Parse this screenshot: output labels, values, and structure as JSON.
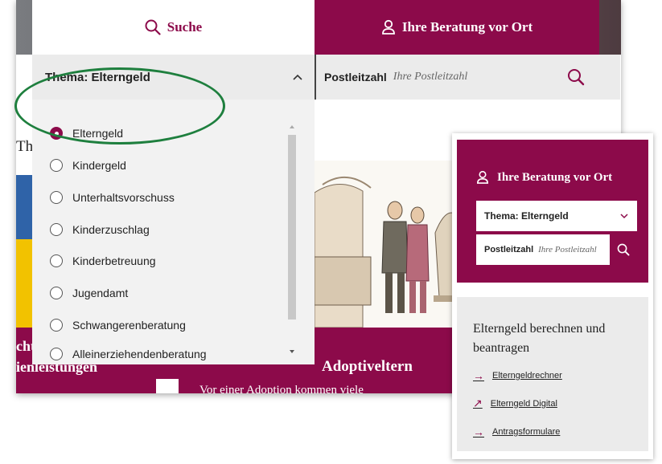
{
  "tabs": {
    "suche": "Suche",
    "ort": "Ihre Beratung vor Ort"
  },
  "search": {
    "thema": "Thema: Elterngeld",
    "plz_label": "Postleitzahl",
    "plz_placeholder": "Ihre Postleitzahl"
  },
  "dropdown": {
    "options": [
      {
        "label": "Elterngeld",
        "selected": true
      },
      {
        "label": "Kindergeld",
        "selected": false
      },
      {
        "label": "Unterhaltsvorschuss",
        "selected": false
      },
      {
        "label": "Kinderzuschlag",
        "selected": false
      },
      {
        "label": "Kinderbetreuung",
        "selected": false
      },
      {
        "label": "Jugendamt",
        "selected": false
      },
      {
        "label": "Schwangerenberatung",
        "selected": false
      },
      {
        "label": "Alleinerziehendenberatung",
        "selected": false
      }
    ]
  },
  "background": {
    "th_fragment": "Th",
    "band_left_line1": "cht",
    "band_left_line2": "ienleistungen",
    "band_title": "Adoptiveltern",
    "band_sub": "Vor einer Adoption kommen viele"
  },
  "card": {
    "title": "Ihre Beratung vor Ort",
    "thema": "Thema: Elterngeld",
    "plz_label": "Postleitzahl",
    "plz_placeholder": "Ihre Postleitzahl",
    "section_title": "Elterngeld berechnen und beantragen",
    "links": [
      {
        "icon": "arrow-right",
        "label": "Elterngeldrechner"
      },
      {
        "icon": "arrow-up-right",
        "label": "Elterngeld Digital"
      },
      {
        "icon": "arrow-right",
        "label": "Antragsformulare"
      }
    ]
  },
  "colors": {
    "brand": "#8c0a4a",
    "highlight_ellipse": "#1e7f3e",
    "panel_grey": "#ebebeb"
  }
}
